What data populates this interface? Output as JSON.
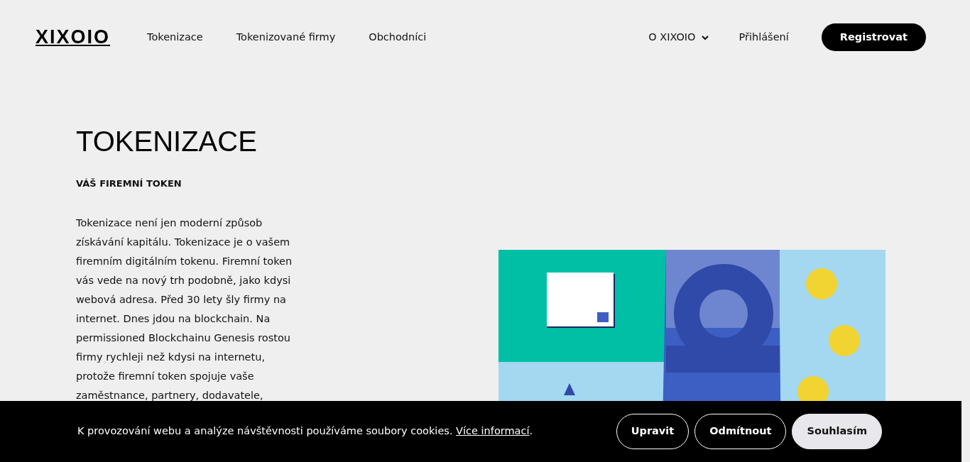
{
  "nav": {
    "logo": "XIXOIO",
    "links": [
      "Tokenizace",
      "Tokenizované firmy",
      "Obchodníci"
    ],
    "about": {
      "label": "O XIXOIO",
      "expanded": false
    },
    "login": "Přihlášení",
    "register": "Registrovat"
  },
  "hero": {
    "title": "TOKENIZACE",
    "subtitle": "VÁŠ FIREMNÍ TOKEN",
    "text": "Tokenizace není jen moderní způsob získávání kapitálu. Tokenizace je o vašem firemním digitálním tokenu. Firemní token vás vede na nový trh podobně, jako kdysi webová adresa. Před 30 lety šly firmy na internet. Dnes jdou na blockchain. Na permissioned Blockchainu Genesis rostou firmy rychleji než kdysi na internetu, protože firemní token spojuje vaše zaměstnance, partnery, dodavatele,"
  },
  "cookie_bar": {
    "text": "K provozování webu a analýze návštěvnosti používáme soubory cookies.",
    "link": "Více informací",
    "after_link": ".",
    "buttons": [
      {
        "label": "Upravit",
        "kind": "outline"
      },
      {
        "label": "Odmítnout",
        "kind": "outline"
      },
      {
        "label": "Souhlasím",
        "kind": "solid"
      }
    ]
  }
}
